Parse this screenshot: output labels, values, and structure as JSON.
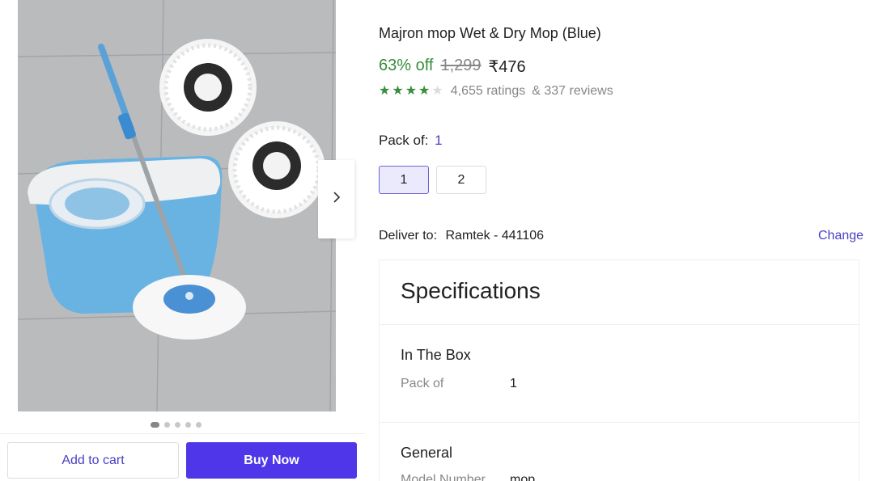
{
  "product": {
    "title": "Majron mop Wet & Dry Mop (Blue)",
    "discount": "63% off",
    "mrp": "1,299",
    "price": "₹476",
    "rating_stars": 4,
    "ratings_count": "4,655 ratings",
    "reviews_count": "& 337 reviews"
  },
  "gallery": {
    "image_count": 5,
    "active_index": 0,
    "next_icon": "chevron-right-icon"
  },
  "pack": {
    "label": "Pack of:",
    "selected_value": "1",
    "options": [
      "1",
      "2"
    ]
  },
  "delivery": {
    "label": "Deliver to:",
    "location": "Ramtek - 441106",
    "change_label": "Change"
  },
  "specifications": {
    "heading": "Specifications",
    "groups": [
      {
        "title": "In The Box",
        "rows": [
          {
            "key": "Pack of",
            "value": "1"
          }
        ]
      },
      {
        "title": "General",
        "rows": [
          {
            "key": "Model Number",
            "value": "mop"
          }
        ]
      }
    ]
  },
  "actions": {
    "add_to_cart": "Add to cart",
    "buy_now": "Buy Now"
  },
  "colors": {
    "accent": "#4f36e8",
    "link": "#4a41c2",
    "discount_green": "#388e3c",
    "muted": "#878787"
  }
}
